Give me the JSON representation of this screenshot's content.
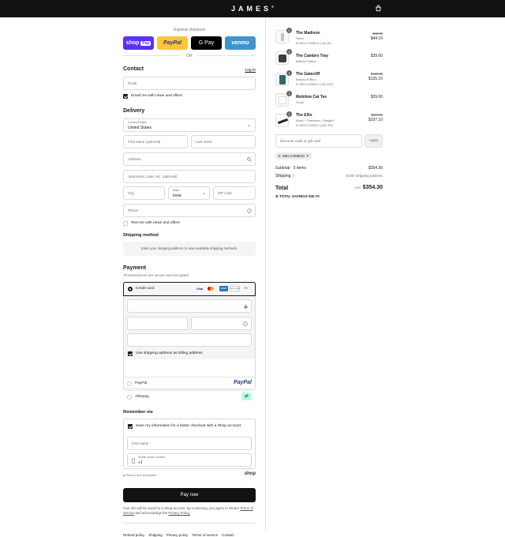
{
  "header": {
    "brand": "JAMES",
    "brand_mark": "®"
  },
  "express": {
    "label": "Express checkout",
    "buttons": [
      {
        "label": "shop",
        "badge": "Pay",
        "color": "#5a31f4"
      },
      {
        "label": "PayPal",
        "color": "#ffc439"
      },
      {
        "label": "G Pay",
        "color": "#000000"
      },
      {
        "label": "venmo",
        "color": "#3d95ce"
      }
    ],
    "or": "OR"
  },
  "contact": {
    "title": "Contact",
    "login": "Log in",
    "email_placeholder": "Email",
    "news_label": "Email me with news and offers"
  },
  "delivery": {
    "title": "Delivery",
    "country_label": "Country/Region",
    "country_value": "United States",
    "first_name": "First name (optional)",
    "last_name": "Last name",
    "address": "Address",
    "apartment": "Apartment, suite, etc. (optional)",
    "city": "City",
    "state_label": "State",
    "state_value": "Iowa",
    "zip": "ZIP code",
    "phone": "Phone",
    "text_label": "Text me with news and offers"
  },
  "shipping": {
    "title": "Shipping method",
    "note": "Enter your shipping address to view available shipping methods."
  },
  "payment": {
    "title": "Payment",
    "subtitle": "All transactions are secure and encrypted.",
    "credit_card": "Credit card",
    "card_brands": [
      "Visa",
      "MC",
      "AMEX",
      "DISCOVER"
    ],
    "more_cards": "+4",
    "billing_label": "Use shipping address as billing address",
    "paypal": "PayPal",
    "paypal_logo": "PayPal",
    "afterpay": "Afterpay"
  },
  "remember": {
    "title": "Remember me",
    "save_label": "Save my information for a faster checkout with a Shop account",
    "first_name": "First name",
    "mobile_label": "Mobile phone number",
    "mobile_value": "+1",
    "secure": "Secure and encrypted",
    "shop_logo": "shop"
  },
  "pay_now": "Pay now",
  "legal": {
    "text1": "Your info will be saved to a Shop account. By continuing, you agree to Shop's",
    "tos": "Terms of Service",
    "text2": "and acknowledge the",
    "privacy": "Privacy Policy."
  },
  "footer_links": [
    "Refund policy",
    "Shipping",
    "Privacy policy",
    "Terms of service",
    "Contact"
  ],
  "cart": {
    "items": [
      {
        "qty": "1",
        "name": "The Madison",
        "variant": "Silver",
        "discount": "WELCOME10 (-$4.40)",
        "old_price": "$48.00",
        "price": "$44.10",
        "thumb_color": "#e9edf0"
      },
      {
        "qty": "1",
        "name": "The Cambro Tray",
        "variant": "Mallow Edition",
        "discount": "",
        "old_price": "",
        "price": "$39.00",
        "thumb_color": "#3a3f44"
      },
      {
        "qty": "1",
        "name": "The Gatecliff",
        "variant": "Mallow Edition",
        "discount": "WELCOME10 (-$13.90)",
        "old_price": "$139.00",
        "price": "$125.10",
        "thumb_color": "#2f6b6b"
      },
      {
        "qty": "1",
        "name": "Mobilow Cat Tee",
        "variant": "Small",
        "discount": "",
        "old_price": "",
        "price": "$39.00",
        "thumb_color": "#f4f4f4"
      },
      {
        "qty": "1",
        "name": "The Ellis",
        "variant": "Black + Stainless / Straight",
        "discount": "WELCOME10 (-$11.90)",
        "old_price": "$119.00",
        "price": "$107.10",
        "thumb_color": "#222222"
      }
    ],
    "discount_placeholder": "Discount code or gift card",
    "apply": "Apply",
    "code": "WELCOME10",
    "subtotal_label": "Subtotal · 5 items",
    "subtotal_value": "$354.30",
    "shipping_label": "Shipping",
    "shipping_value": "Enter shipping address",
    "total_label": "Total",
    "currency": "USD",
    "total_value": "$354.30",
    "savings_label": "TOTAL SAVINGS",
    "savings_value": "$30.70"
  }
}
